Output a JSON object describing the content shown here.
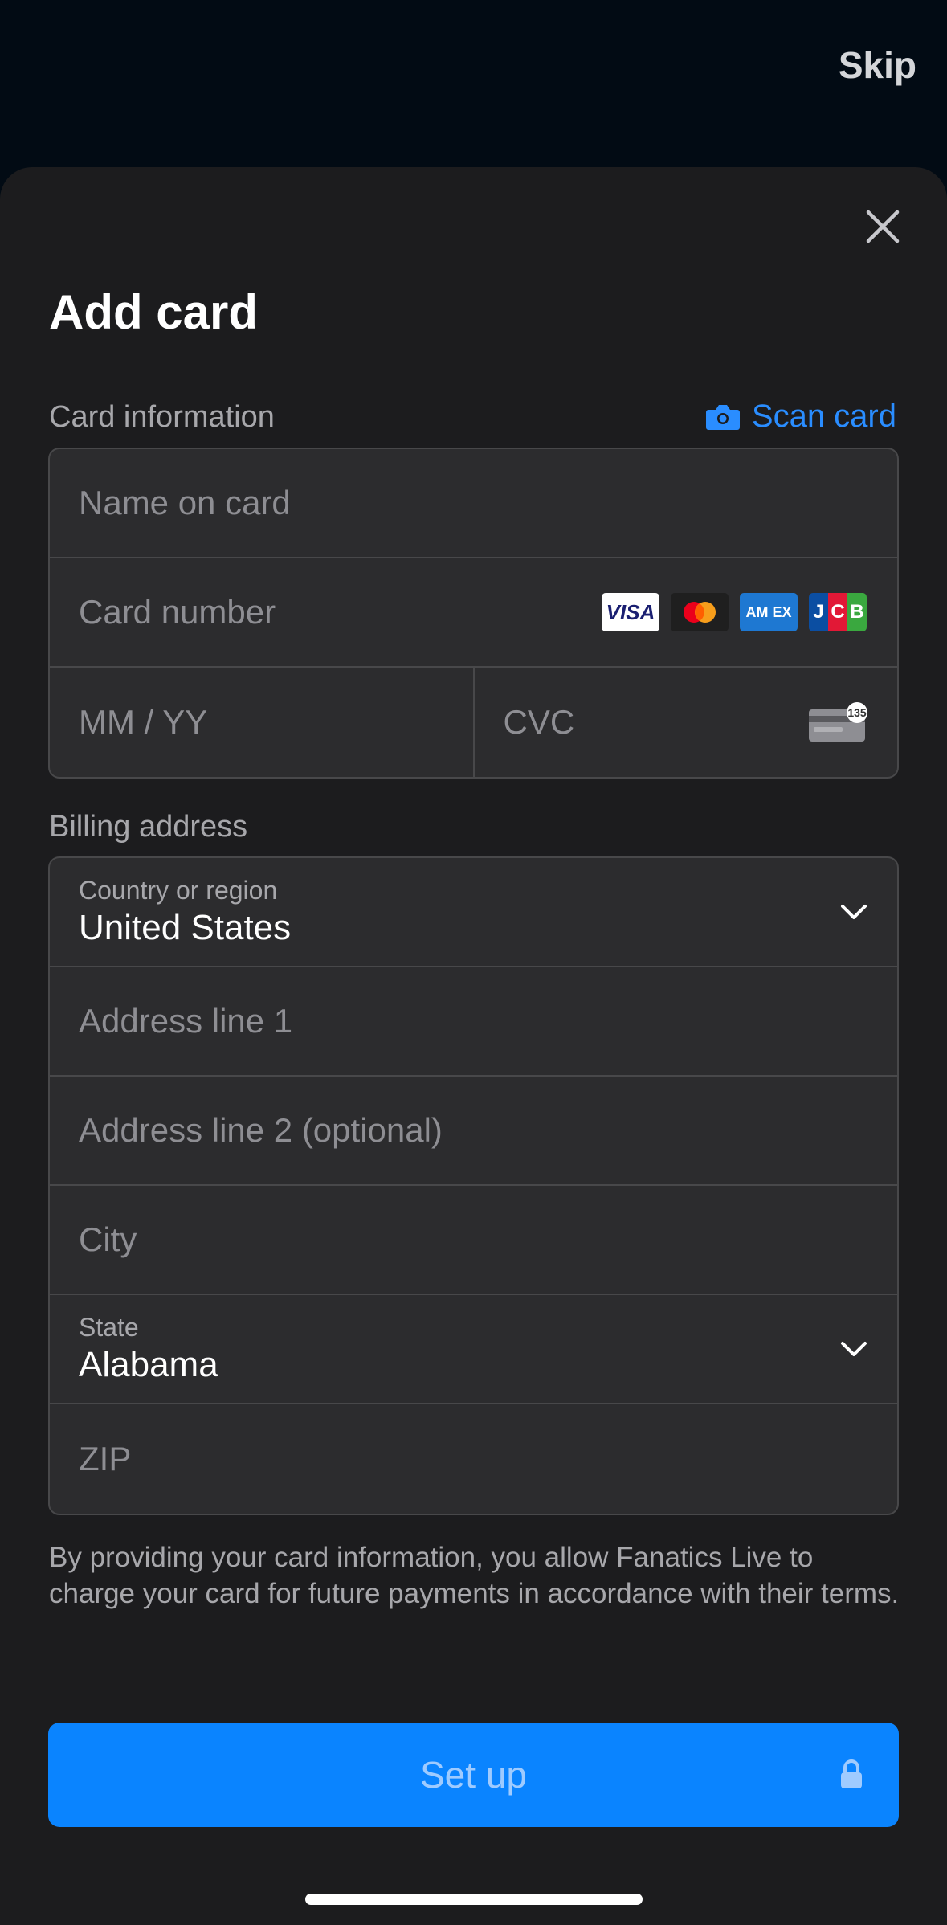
{
  "top": {
    "skip_label": "Skip"
  },
  "sheet": {
    "title": "Add card",
    "card_section_label": "Card information",
    "scan_label": "Scan card",
    "card_fields": {
      "name_placeholder": "Name on card",
      "number_placeholder": "Card number",
      "expiry_placeholder": "MM / YY",
      "cvc_placeholder": "CVC",
      "brands": [
        {
          "name": "VISA",
          "icon": "visa-logo"
        },
        {
          "name": "",
          "icon": "mastercard-logo"
        },
        {
          "name": "AM EX",
          "icon": "amex-logo"
        },
        {
          "name": "JCB",
          "icon": "jcb-logo"
        }
      ],
      "cvc_icon_text": "135"
    },
    "billing_section_label": "Billing address",
    "billing_fields": {
      "country_label": "Country or region",
      "country_value": "United States",
      "address1_placeholder": "Address line 1",
      "address2_placeholder": "Address line 2 (optional)",
      "city_placeholder": "City",
      "state_label": "State",
      "state_value": "Alabama",
      "zip_placeholder": "ZIP"
    },
    "disclaimer": "By providing your card information, you allow Fanatics Live to charge your card for future payments in accordance with their terms.",
    "setup_label": "Set up"
  },
  "colors": {
    "accent": "#0a84ff",
    "link": "#2a8dff",
    "sheet_bg": "#1c1c1e",
    "field_bg": "#2c2c2e",
    "page_bg": "#020b14"
  }
}
